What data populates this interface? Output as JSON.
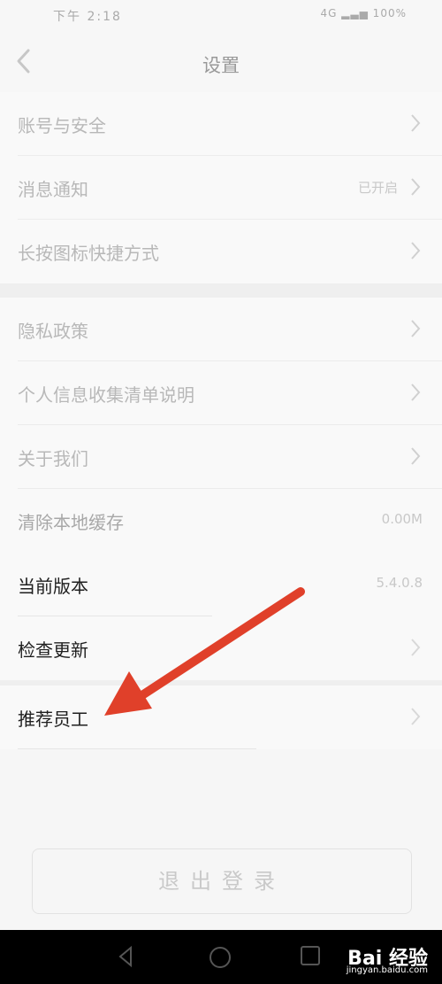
{
  "status": {
    "time": "下午 2:18",
    "right": "4G ▂▃▅ 100%"
  },
  "header": {
    "title": "设置"
  },
  "group1": [
    {
      "label": "账号与安全",
      "value": "",
      "dark": false
    },
    {
      "label": "消息通知",
      "value": "已开启",
      "dark": false
    },
    {
      "label": "长按图标快捷方式",
      "value": "",
      "dark": false
    }
  ],
  "group2": [
    {
      "label": "隐私政策",
      "value": "",
      "dark": false
    },
    {
      "label": "个人信息收集清单说明",
      "value": "",
      "dark": false
    },
    {
      "label": "关于我们",
      "value": "",
      "dark": false
    },
    {
      "label": "清除本地缓存",
      "value": "0.00M",
      "dark": false
    },
    {
      "label": "当前版本",
      "value": "5.4.0.8",
      "dark": true
    },
    {
      "label": "检查更新",
      "value": "",
      "dark": true
    }
  ],
  "group3": [
    {
      "label": "推荐员工",
      "value": "",
      "dark": true
    }
  ],
  "logout": {
    "label": "退出登录"
  },
  "watermark": {
    "main": "Bai 经验",
    "sub": "jingyan.baidu.com"
  },
  "annotation": {
    "color": "#e0402a"
  }
}
